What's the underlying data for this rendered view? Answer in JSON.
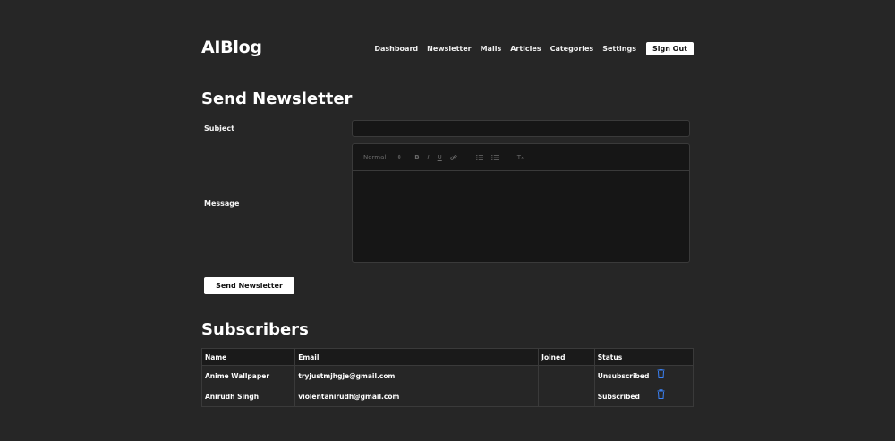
{
  "header": {
    "logo": "AIBlog",
    "nav": [
      "Dashboard",
      "Newsletter",
      "Mails",
      "Articles",
      "Categories",
      "Settings"
    ],
    "signout_label": "Sign Out"
  },
  "newsletter": {
    "title": "Send Newsletter",
    "subject_label": "Subject",
    "subject_value": "",
    "message_label": "Message",
    "toolbar": {
      "header_select": "Normal",
      "header_arrow": "⇕",
      "bold": "B",
      "italic": "I",
      "underline": "U",
      "clean": "Tₓ"
    },
    "send_label": "Send Newsletter"
  },
  "subscribers": {
    "title": "Subscribers",
    "columns": [
      "Name",
      "Email",
      "Joined",
      "Status",
      ""
    ],
    "rows": [
      {
        "name": "Anime Wallpaper",
        "email": "tryjustmjhgje@gmail.com",
        "joined": "",
        "status": "Unsubscribed"
      },
      {
        "name": "Anirudh Singh",
        "email": "violentanirudh@gmail.com",
        "joined": "",
        "status": "Subscribed"
      }
    ]
  },
  "icons": {
    "trash": "trash-icon",
    "link": "link-icon",
    "ordered_list": "ordered-list-icon",
    "bullet_list": "bullet-list-icon"
  },
  "colors": {
    "background": "#262626",
    "input_background": "#161616",
    "trash_icon": "#3b82f6"
  }
}
